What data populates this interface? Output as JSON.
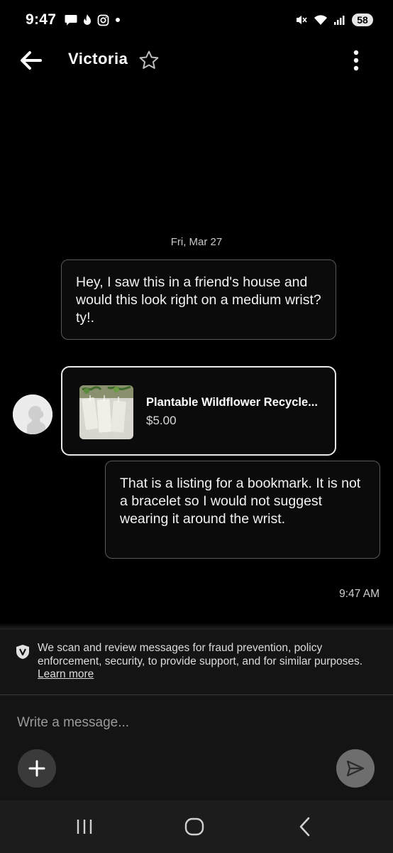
{
  "status_bar": {
    "time": "9:47",
    "battery": "58",
    "icons": [
      "chat-bubble-icon",
      "tinder-flame-icon",
      "instagram-icon",
      "dot-icon",
      "mute-icon",
      "wifi-icon",
      "signal-icon"
    ]
  },
  "header": {
    "title": "Victoria",
    "icons": [
      "back-arrow-icon",
      "star-outline-icon",
      "more-vertical-icon"
    ]
  },
  "conversation": {
    "date_separator": "Fri, Mar 27",
    "incoming_message": "Hey, I saw this in a friend's house and would this look right on a medium wrist? ty!.",
    "listing_card": {
      "title": "Plantable Wildflower Recycle...",
      "price": "$5.00"
    },
    "outgoing_message": "That is a listing for a bookmark. It is not a bracelet so I would not suggest wearing it around the wrist.",
    "timestamp": "9:47 AM"
  },
  "notice": {
    "text": "We scan and review messages for fraud prevention, policy enforcement, security, to provide support, and for similar purposes.",
    "link": "Learn more"
  },
  "composer": {
    "placeholder": "Write a message...",
    "value": ""
  },
  "colors": {
    "background": "#000000",
    "bubble_border": "#5a5a5a",
    "listing_border": "#e8e8e8",
    "composer_bg": "#141414",
    "send_button": "#6e6e6e",
    "add_button": "#3a3a3a"
  }
}
